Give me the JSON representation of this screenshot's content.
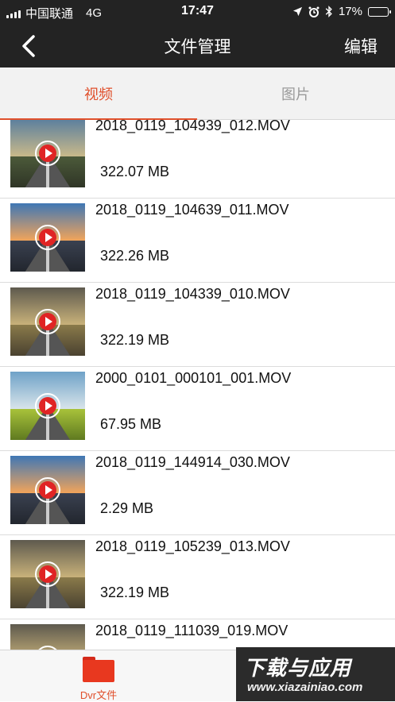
{
  "status_bar": {
    "carrier": "中国联通",
    "network": "4G",
    "time": "17:47",
    "battery": "17%",
    "battery_level": 0.17,
    "battery_color": "#f5c518"
  },
  "nav": {
    "back_icon": "chevron-left-icon",
    "title": "文件管理",
    "edit_label": "编辑"
  },
  "tabs": [
    {
      "label": "视频",
      "active": true
    },
    {
      "label": "图片",
      "active": false
    }
  ],
  "files": [
    {
      "name": "2018_0119_104939_012.MOV",
      "size": "322.07 MB",
      "thumb": "forest-road"
    },
    {
      "name": "2018_0119_104639_011.MOV",
      "size": "322.26 MB",
      "thumb": "sunset-road"
    },
    {
      "name": "2018_0119_104339_010.MOV",
      "size": "322.19 MB",
      "thumb": "cloudy-road"
    },
    {
      "name": "2000_0101_000101_001.MOV",
      "size": "67.95 MB",
      "thumb": "meadow-road"
    },
    {
      "name": "2018_0119_144914_030.MOV",
      "size": "2.29 MB",
      "thumb": "sunset-road"
    },
    {
      "name": "2018_0119_105239_013.MOV",
      "size": "322.19 MB",
      "thumb": "cloudy-road"
    },
    {
      "name": "2018_0119_111039_019.MOV",
      "size": "",
      "thumb": "cloudy-road"
    }
  ],
  "bottom_tab": {
    "label": "Dvr文件",
    "icon": "folder-icon"
  },
  "watermark": {
    "title": "下载与应用",
    "url": "www.xiazainiao.com"
  },
  "colors": {
    "accent": "#e0502c",
    "play": "#e02424",
    "header": "#232323"
  }
}
